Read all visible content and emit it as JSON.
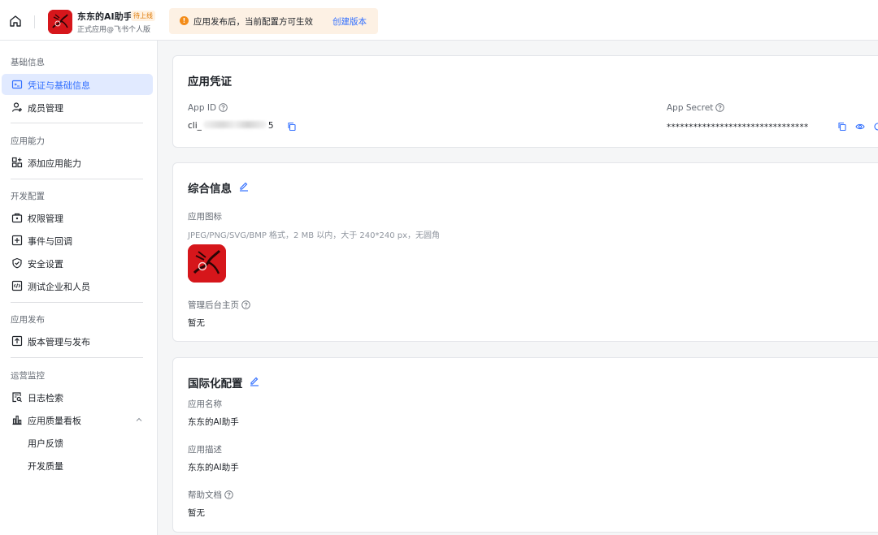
{
  "header": {
    "app_name": "东东的AI助手",
    "app_badge": "待上线",
    "app_sub": "正式应用@飞书个人版",
    "notice_text": "应用发布后，当前配置方可生效",
    "notice_link": "创建版本"
  },
  "sidebar": {
    "sections": [
      {
        "title": "基础信息",
        "items": [
          {
            "label": "凭证与基础信息",
            "icon": "credential-icon",
            "active": true
          },
          {
            "label": "成员管理",
            "icon": "user-icon"
          }
        ]
      },
      {
        "title": "应用能力",
        "items": [
          {
            "label": "添加应用能力",
            "icon": "add-grid-icon"
          }
        ]
      },
      {
        "title": "开发配置",
        "items": [
          {
            "label": "权限管理",
            "icon": "lock-box-icon"
          },
          {
            "label": "事件与回调",
            "icon": "event-icon"
          },
          {
            "label": "安全设置",
            "icon": "shield-icon"
          },
          {
            "label": "测试企业和人员",
            "icon": "code-box-icon"
          }
        ]
      },
      {
        "title": "应用发布",
        "items": [
          {
            "label": "版本管理与发布",
            "icon": "upload-box-icon"
          }
        ]
      },
      {
        "title": "运营监控",
        "items": [
          {
            "label": "日志检索",
            "icon": "log-search-icon"
          },
          {
            "label": "应用质量看板",
            "icon": "bar-chart-icon"
          },
          {
            "label": "用户反馈"
          },
          {
            "label": "开发质量"
          }
        ]
      }
    ]
  },
  "credentials": {
    "title": "应用凭证",
    "app_id_label": "App ID",
    "app_id_prefix": "cli_",
    "app_id_suffix": "5",
    "app_secret_label": "App Secret",
    "app_secret_value": "********************************"
  },
  "general": {
    "title": "综合信息",
    "icon_label": "应用图标",
    "icon_hint": "JPEG/PNG/SVG/BMP 格式，2 MB 以内，大于 240*240 px，无圆角",
    "admin_label": "管理后台主页",
    "admin_value": "暂无"
  },
  "i18n": {
    "title": "国际化配置",
    "name_label": "应用名称",
    "name_value": "东东的AI助手",
    "desc_label": "应用描述",
    "desc_value": "东东的AI助手",
    "help_label": "帮助文档",
    "help_value": "暂无"
  },
  "colors": {
    "accent": "#3370ff",
    "active_bg": "#e1eaff",
    "brand_red": "#d6161b",
    "notice_bg": "#fdf1e4",
    "notice_dot": "#f38c19"
  }
}
